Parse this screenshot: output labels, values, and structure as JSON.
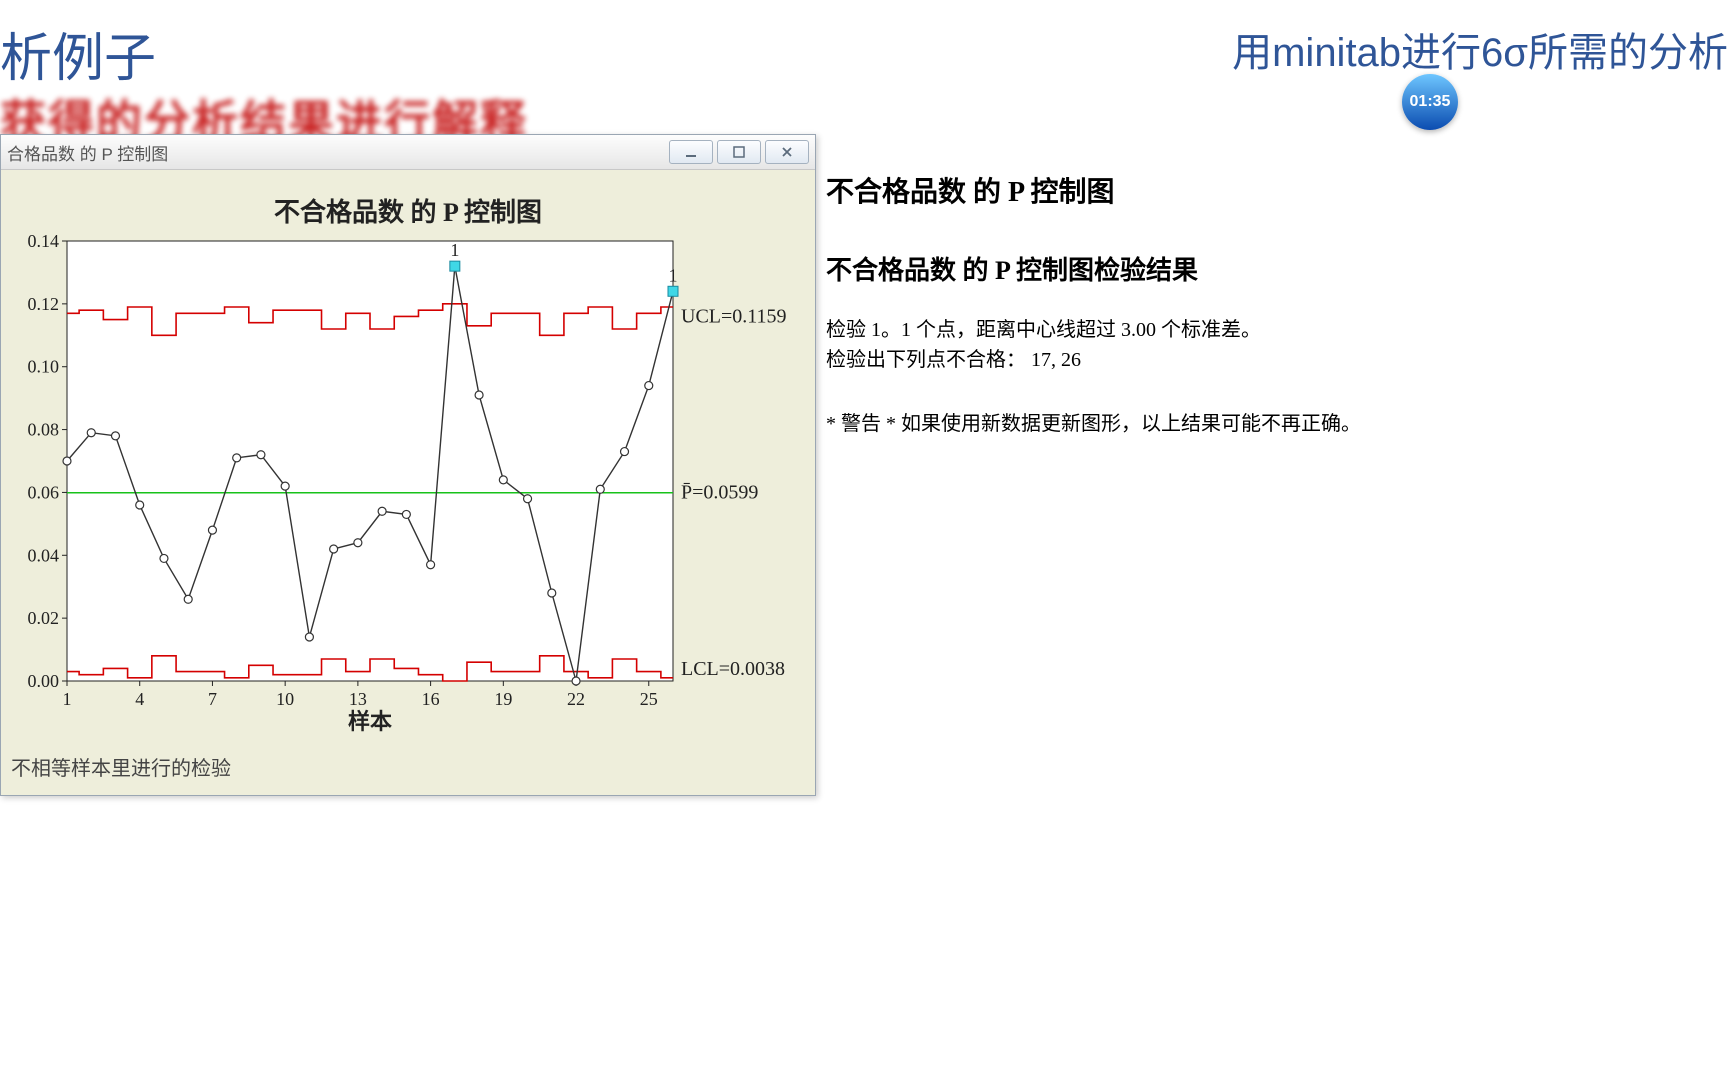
{
  "header": {
    "left_fragment": "析例子",
    "right_fragment": "用minitab进行6σ所需的分析",
    "timer": "01:35",
    "blur_text": "获得的分析结果进行解释"
  },
  "window": {
    "title_fragment": "合格品数 的 P 控制图"
  },
  "chart": {
    "title": "不合格品数 的 P 控制图",
    "xlabel": "样本",
    "footnote": "不相等样本里进行的检验",
    "ucl_label": "UCL=0.1159",
    "pbar_label": "P̄=0.0599",
    "lcl_label": "LCL=0.0038",
    "y_ticks": [
      "0.00",
      "0.02",
      "0.04",
      "0.06",
      "0.08",
      "0.10",
      "0.12",
      "0.14"
    ],
    "x_ticks": [
      "1",
      "4",
      "7",
      "10",
      "13",
      "16",
      "19",
      "22",
      "25"
    ],
    "outlier_label": "1"
  },
  "results": {
    "h1": "不合格品数 的 P 控制图",
    "h2": "不合格品数 的 P 控制图检验结果",
    "line1": "检验 1。1 个点，距离中心线超过 3.00 个标准差。",
    "line2": "检验出下列点不合格：  17, 26",
    "warn": "* 警告 * 如果使用新数据更新图形，以上结果可能不再正确。"
  },
  "chart_data": {
    "type": "line",
    "title": "不合格品数 的 P 控制图",
    "xlabel": "样本",
    "ylabel": "",
    "ylim": [
      0,
      0.14
    ],
    "p_bar": 0.0599,
    "x": [
      1,
      2,
      3,
      4,
      5,
      6,
      7,
      8,
      9,
      10,
      11,
      12,
      13,
      14,
      15,
      16,
      17,
      18,
      19,
      20,
      21,
      22,
      23,
      24,
      25,
      26
    ],
    "values": [
      0.07,
      0.079,
      0.078,
      0.056,
      0.039,
      0.026,
      0.048,
      0.071,
      0.072,
      0.062,
      0.014,
      0.042,
      0.044,
      0.054,
      0.053,
      0.037,
      0.132,
      0.091,
      0.064,
      0.058,
      0.028,
      0.0,
      0.061,
      0.073,
      0.094,
      0.124
    ],
    "ucl": [
      0.117,
      0.118,
      0.115,
      0.119,
      0.11,
      0.117,
      0.117,
      0.119,
      0.114,
      0.118,
      0.118,
      0.112,
      0.117,
      0.112,
      0.116,
      0.118,
      0.12,
      0.113,
      0.117,
      0.117,
      0.11,
      0.117,
      0.119,
      0.112,
      0.117,
      0.119
    ],
    "lcl": [
      0.003,
      0.002,
      0.004,
      0.001,
      0.008,
      0.003,
      0.003,
      0.001,
      0.005,
      0.002,
      0.002,
      0.007,
      0.003,
      0.007,
      0.004,
      0.002,
      0.0,
      0.006,
      0.003,
      0.003,
      0.008,
      0.003,
      0.001,
      0.007,
      0.003,
      0.001
    ],
    "outliers": [
      17,
      26
    ],
    "annotations": [
      {
        "text": "UCL=0.1159",
        "y": 0.1159
      },
      {
        "text": "P̄=0.0599",
        "y": 0.0599
      },
      {
        "text": "LCL=0.0038",
        "y": 0.0038
      }
    ]
  }
}
